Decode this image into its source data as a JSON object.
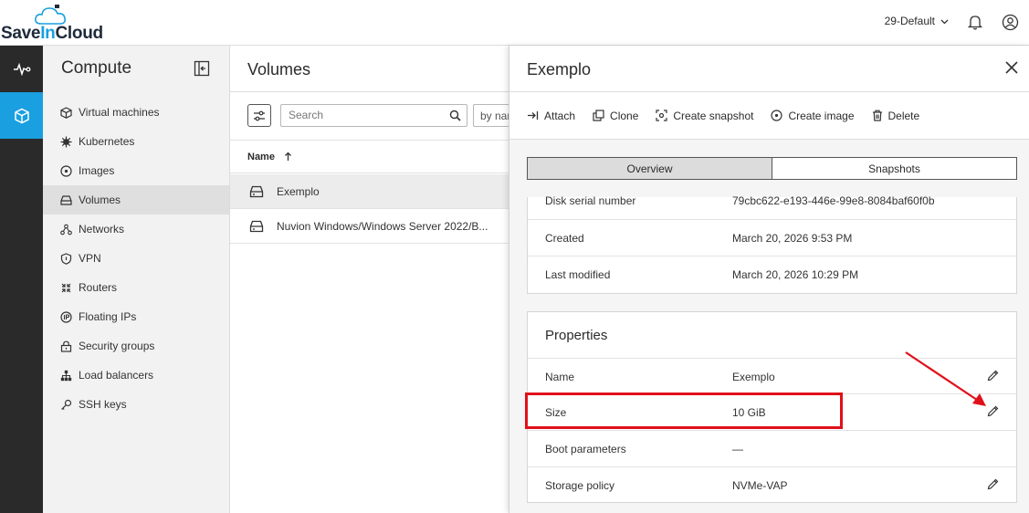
{
  "brand": {
    "save": "Save",
    "in": "In",
    "cloud": "Cloud"
  },
  "header": {
    "tenant": "29-Default"
  },
  "sidebar": {
    "title": "Compute",
    "items": [
      {
        "label": "Virtual machines",
        "icon": "cube-icon"
      },
      {
        "label": "Kubernetes",
        "icon": "helm-icon"
      },
      {
        "label": "Images",
        "icon": "disc-icon"
      },
      {
        "label": "Volumes",
        "icon": "drive-icon",
        "active": true
      },
      {
        "label": "Networks",
        "icon": "network-icon"
      },
      {
        "label": "VPN",
        "icon": "shield-icon"
      },
      {
        "label": "Routers",
        "icon": "router-icon"
      },
      {
        "label": "Floating IPs",
        "icon": "ip-icon"
      },
      {
        "label": "Security groups",
        "icon": "lock-icon"
      },
      {
        "label": "Load balancers",
        "icon": "hierarchy-icon"
      },
      {
        "label": "SSH keys",
        "icon": "key-icon"
      }
    ]
  },
  "volumes": {
    "title": "Volumes",
    "search_placeholder": "Search",
    "sort_label": "by nar",
    "column_name": "Name",
    "rows": [
      {
        "name": "Exemplo",
        "selected": true
      },
      {
        "name": "Nuvion Windows/Windows Server 2022/B..."
      }
    ]
  },
  "panel": {
    "title": "Exemplo",
    "toolbar": {
      "attach": "Attach",
      "clone": "Clone",
      "snapshot": "Create snapshot",
      "image": "Create image",
      "delete": "Delete"
    },
    "tabs": {
      "overview": "Overview",
      "snapshots": "Snapshots"
    },
    "info": [
      {
        "key": "Disk serial number",
        "value": "79cbc622-e193-446e-99e8-8084baf60f0b"
      },
      {
        "key": "Created",
        "value": "March 20, 2026 9:53 PM"
      },
      {
        "key": "Last modified",
        "value": "March 20, 2026 10:29 PM"
      }
    ],
    "properties": {
      "title": "Properties",
      "rows": [
        {
          "key": "Name",
          "value": "Exemplo",
          "editable": true
        },
        {
          "key": "Size",
          "value": "10 GiB",
          "editable": true
        },
        {
          "key": "Boot parameters",
          "value": "—",
          "editable": false
        },
        {
          "key": "Storage policy",
          "value": "NVMe-VAP",
          "editable": true
        }
      ]
    }
  },
  "colors": {
    "accent": "#1a9fe0",
    "rail": "#2a2a2a",
    "annotation": "#e0101a"
  }
}
